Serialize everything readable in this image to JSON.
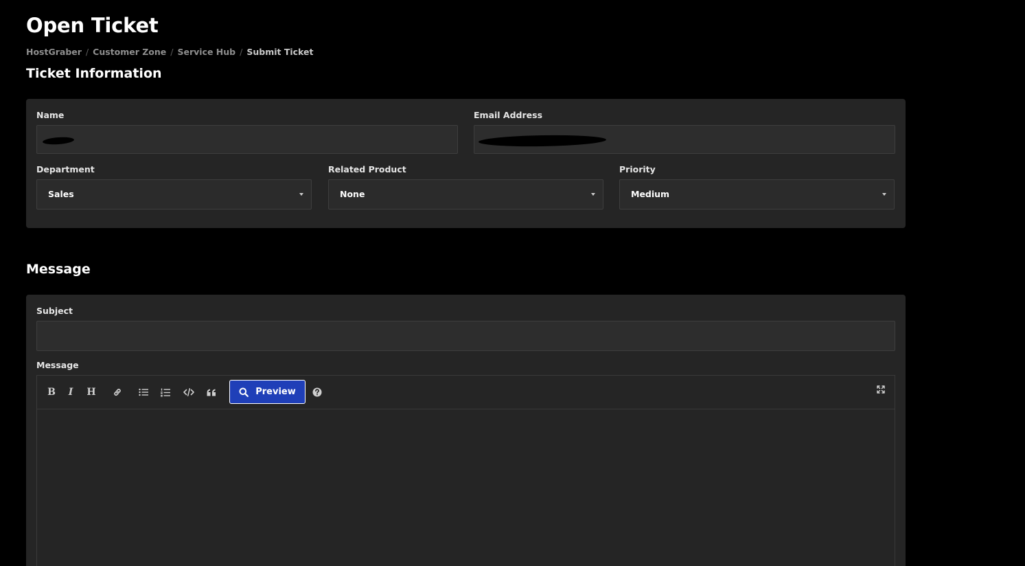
{
  "page": {
    "title": "Open Ticket"
  },
  "breadcrumb": [
    {
      "label": "HostGraber"
    },
    {
      "label": "Customer Zone"
    },
    {
      "label": "Service Hub"
    },
    {
      "label": "Submit Ticket"
    }
  ],
  "ticket_info": {
    "heading": "Ticket Information",
    "name": {
      "label": "Name",
      "value": ""
    },
    "email": {
      "label": "Email Address",
      "value": ""
    },
    "department": {
      "label": "Department",
      "selected": "Sales"
    },
    "related_product": {
      "label": "Related Product",
      "selected": "None"
    },
    "priority": {
      "label": "Priority",
      "selected": "Medium"
    }
  },
  "message_section": {
    "heading": "Message",
    "subject": {
      "label": "Subject",
      "value": ""
    },
    "message": {
      "label": "Message",
      "value": ""
    },
    "toolbar": {
      "bold": "B",
      "italic": "I",
      "heading": "H",
      "preview_label": "Preview",
      "icons": [
        "bold-icon",
        "italic-icon",
        "heading-icon",
        "link-icon",
        "bullet-list-icon",
        "numbered-list-icon",
        "code-icon",
        "quote-icon",
        "search-icon",
        "help-icon",
        "fullscreen-icon"
      ]
    }
  },
  "colors": {
    "background": "#000000",
    "card": "#252525",
    "input": "#2d2d2d",
    "border": "#3e3e3e",
    "accent": "#1f3fb8",
    "breadcrumb": "#8f8f8f"
  }
}
